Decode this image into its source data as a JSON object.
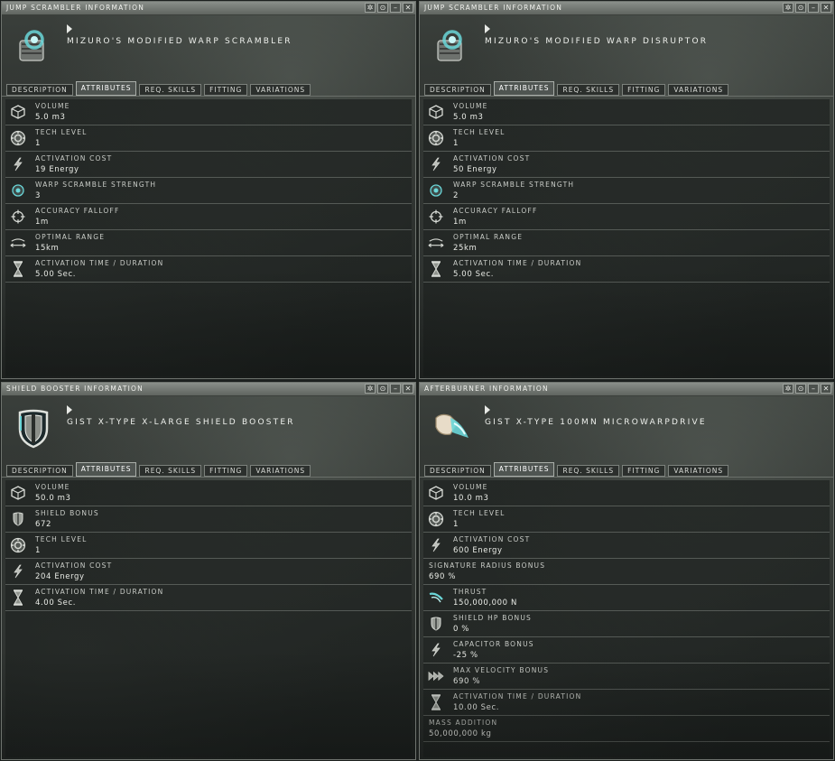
{
  "windows": [
    {
      "title": "JUMP SCRAMBLER INFORMATION",
      "item_name": "MIZURO'S MODIFIED WARP SCRAMBLER",
      "item_icon": "warp-scrambler-icon",
      "tabs": [
        "DESCRIPTION",
        "ATTRIBUTES",
        "REQ. SKILLS",
        "FITTING",
        "VARIATIONS"
      ],
      "active_tab": "ATTRIBUTES",
      "attributes": [
        {
          "label": "VOLUME",
          "value": "5.0 m3",
          "icon": "volume-icon"
        },
        {
          "label": "TECH LEVEL",
          "value": "1",
          "icon": "tech-level-icon"
        },
        {
          "label": "ACTIVATION COST",
          "value": "19 Energy",
          "icon": "activation-cost-icon"
        },
        {
          "label": "WARP SCRAMBLE STRENGTH",
          "value": "3",
          "icon": "warp-scramble-strength-icon"
        },
        {
          "label": "ACCURACY FALLOFF",
          "value": "1m",
          "icon": "accuracy-falloff-icon"
        },
        {
          "label": "OPTIMAL RANGE",
          "value": "15km",
          "icon": "optimal-range-icon"
        },
        {
          "label": "ACTIVATION TIME / DURATION",
          "value": "5.00 Sec.",
          "icon": "activation-time-icon"
        }
      ]
    },
    {
      "title": "JUMP SCRAMBLER INFORMATION",
      "item_name": "MIZURO'S MODIFIED WARP DISRUPTOR",
      "item_icon": "warp-disruptor-icon",
      "tabs": [
        "DESCRIPTION",
        "ATTRIBUTES",
        "REQ. SKILLS",
        "FITTING",
        "VARIATIONS"
      ],
      "active_tab": "ATTRIBUTES",
      "attributes": [
        {
          "label": "VOLUME",
          "value": "5.0 m3",
          "icon": "volume-icon"
        },
        {
          "label": "TECH LEVEL",
          "value": "1",
          "icon": "tech-level-icon"
        },
        {
          "label": "ACTIVATION COST",
          "value": "50 Energy",
          "icon": "activation-cost-icon"
        },
        {
          "label": "WARP SCRAMBLE STRENGTH",
          "value": "2",
          "icon": "warp-scramble-strength-icon"
        },
        {
          "label": "ACCURACY FALLOFF",
          "value": "1m",
          "icon": "accuracy-falloff-icon"
        },
        {
          "label": "OPTIMAL RANGE",
          "value": "25km",
          "icon": "optimal-range-icon"
        },
        {
          "label": "ACTIVATION TIME / DURATION",
          "value": "5.00 Sec.",
          "icon": "activation-time-icon"
        }
      ]
    },
    {
      "title": "SHIELD BOOSTER INFORMATION",
      "item_name": "GIST X-TYPE X-LARGE SHIELD BOOSTER",
      "item_icon": "shield-booster-icon",
      "tabs": [
        "DESCRIPTION",
        "ATTRIBUTES",
        "REQ. SKILLS",
        "FITTING",
        "VARIATIONS"
      ],
      "active_tab": "ATTRIBUTES",
      "attributes": [
        {
          "label": "VOLUME",
          "value": "50.0 m3",
          "icon": "volume-icon"
        },
        {
          "label": "SHIELD BONUS",
          "value": "672",
          "icon": "shield-bonus-icon"
        },
        {
          "label": "TECH LEVEL",
          "value": "1",
          "icon": "tech-level-icon"
        },
        {
          "label": "ACTIVATION COST",
          "value": "204 Energy",
          "icon": "activation-cost-icon"
        },
        {
          "label": "ACTIVATION TIME / DURATION",
          "value": "4.00 Sec.",
          "icon": "activation-time-icon"
        }
      ]
    },
    {
      "title": "AFTERBURNER INFORMATION",
      "item_name": "GIST X-TYPE 100MN MICROWARPDRIVE",
      "item_icon": "microwarpdrive-icon",
      "tabs": [
        "DESCRIPTION",
        "ATTRIBUTES",
        "REQ. SKILLS",
        "FITTING",
        "VARIATIONS"
      ],
      "active_tab": "ATTRIBUTES",
      "attributes": [
        {
          "label": "VOLUME",
          "value": "10.0 m3",
          "icon": "volume-icon"
        },
        {
          "label": "TECH LEVEL",
          "value": "1",
          "icon": "tech-level-icon"
        },
        {
          "label": "ACTIVATION COST",
          "value": "600 Energy",
          "icon": "activation-cost-icon"
        },
        {
          "label": "SIGNATURE RADIUS BONUS",
          "value": "690 %",
          "icon": ""
        },
        {
          "label": "THRUST",
          "value": "150,000,000 N",
          "icon": "thrust-icon"
        },
        {
          "label": "SHIELD HP BONUS",
          "value": "0 %",
          "icon": "shield-bonus-icon"
        },
        {
          "label": "CAPACITOR BONUS",
          "value": "-25 %",
          "icon": "capacitor-bonus-icon"
        },
        {
          "label": "MAX VELOCITY BONUS",
          "value": "690 %",
          "icon": "max-velocity-icon"
        },
        {
          "label": "ACTIVATION TIME / DURATION",
          "value": "10.00 Sec.",
          "icon": "activation-time-icon"
        },
        {
          "label": "MASS ADDITION",
          "value": "50,000,000 kg",
          "icon": ""
        }
      ]
    }
  ],
  "window_buttons": [
    {
      "name": "pin-icon",
      "glyph": "✲"
    },
    {
      "name": "settings-icon",
      "glyph": "⊙"
    },
    {
      "name": "minimize-icon",
      "glyph": "–"
    },
    {
      "name": "close-icon",
      "glyph": "✕"
    }
  ],
  "colors": {
    "accent_cyan": "#6ad6d8",
    "label_text": "#c9ccc7",
    "value_text": "#e9ebe6"
  }
}
